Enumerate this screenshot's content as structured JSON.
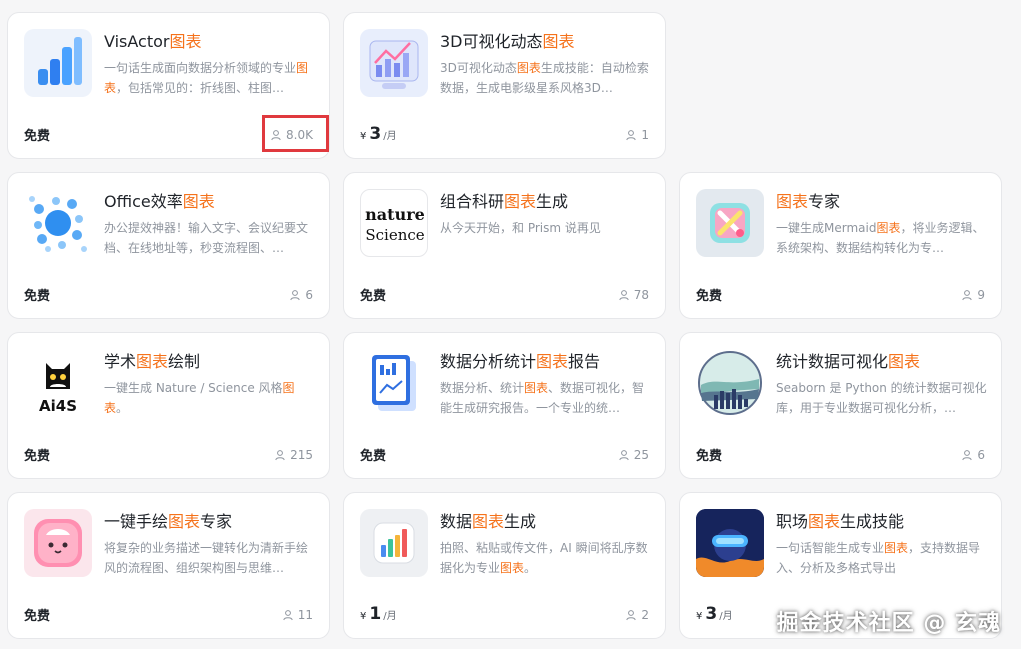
{
  "accent_color": "#f5721b",
  "cards": [
    {
      "title_pre": "VisActor",
      "title_hl": "图表",
      "title_post": "",
      "desc_pre": "一句话生成面向数据分析领域的专业",
      "desc_hl": "图表",
      "desc_post": "，包括常见的：折线图、柱图…",
      "price_big": "",
      "price_text": "免费",
      "price_unit": "",
      "users": "8.0K",
      "icon": "bar-chart-3d-icon"
    },
    {
      "title_pre": "3D可视化动态",
      "title_hl": "图表",
      "title_post": "",
      "desc_pre": "3D可视化动态",
      "desc_hl": "图表",
      "desc_post": "生成技能：自动检索数据，生成电影级星系风格3D…",
      "price_big": "3",
      "price_text": "",
      "price_unit": "/月",
      "users": "1",
      "icon": "line-chart-3d-icon"
    },
    {
      "title_pre": "Office效率",
      "title_hl": "图表",
      "title_post": "",
      "desc_pre": "办公提效神器！输入文字、会议纪要文档、在线地址等，秒变流程图、…",
      "desc_hl": "",
      "desc_post": "",
      "price_big": "",
      "price_text": "免费",
      "price_unit": "",
      "users": "6",
      "icon": "bubble-dots-icon"
    },
    {
      "title_pre": "组合科研",
      "title_hl": "图表",
      "title_post": "生成",
      "desc_pre": "从今天开始，和 Prism 说再见",
      "desc_hl": "",
      "desc_post": "",
      "price_big": "",
      "price_text": "免费",
      "price_unit": "",
      "users": "78",
      "icon": "nature-science-logo"
    },
    {
      "title_pre": "",
      "title_hl": "图表",
      "title_post": "专家",
      "desc_pre": "一键生成Mermaid",
      "desc_hl": "图表",
      "desc_post": "，将业务逻辑、系统架构、数据结构转化为专…",
      "price_big": "",
      "price_text": "免费",
      "price_unit": "",
      "users": "9",
      "icon": "tools-3d-icon"
    },
    {
      "title_pre": "学术",
      "title_hl": "图表",
      "title_post": "绘制",
      "desc_pre": "一键生成 Nature / Science 风格",
      "desc_hl": "图表",
      "desc_post": "。",
      "price_big": "",
      "price_text": "免费",
      "price_unit": "",
      "users": "215",
      "icon": "ai4s-cat-logo",
      "logo_text": "Ai4S"
    },
    {
      "title_pre": "数据分析统计",
      "title_hl": "图表",
      "title_post": "报告",
      "desc_pre": "数据分析、统计",
      "desc_hl": "图表",
      "desc_post": "、数据可视化，智能生成研究报告。一个专业的统…",
      "price_big": "",
      "price_text": "免费",
      "price_unit": "",
      "users": "25",
      "icon": "report-document-icon"
    },
    {
      "title_pre": "统计数据可视化",
      "title_hl": "图表",
      "title_post": "",
      "desc_pre": "Seaborn 是 Python 的统计数据可视化库，用于专业数据可视化分析，…",
      "desc_hl": "",
      "desc_post": "",
      "price_big": "",
      "price_text": "免费",
      "price_unit": "",
      "users": "6",
      "icon": "seaborn-logo"
    },
    {
      "title_pre": "一键手绘",
      "title_hl": "图表",
      "title_post": "专家",
      "desc_pre": "将复杂的业务描述一键转化为清新手绘风的流程图、组织架构图与思维…",
      "desc_hl": "",
      "desc_post": "",
      "price_big": "",
      "price_text": "免费",
      "price_unit": "",
      "users": "11",
      "icon": "cute-blob-icon"
    },
    {
      "title_pre": "数据",
      "title_hl": "图表",
      "title_post": "生成",
      "desc_pre": "拍照、粘贴或传文件，AI 瞬间将乱序数据化为专业",
      "desc_hl": "图表",
      "desc_post": "。",
      "price_big": "1",
      "price_text": "",
      "price_unit": "/月",
      "users": "2",
      "icon": "bar-chart-app-icon"
    },
    {
      "title_pre": "职场",
      "title_hl": "图表",
      "title_post": "生成技能",
      "desc_pre": "一句话智能生成专业",
      "desc_hl": "图表",
      "desc_post": "，支持数据导入、分析及多格式导出",
      "price_big": "3",
      "price_text": "",
      "price_unit": "/月",
      "users": "",
      "icon": "vr-person-icon"
    }
  ],
  "currency_symbol": "¥",
  "watermark": "掘金技术社区 @ 玄魂"
}
